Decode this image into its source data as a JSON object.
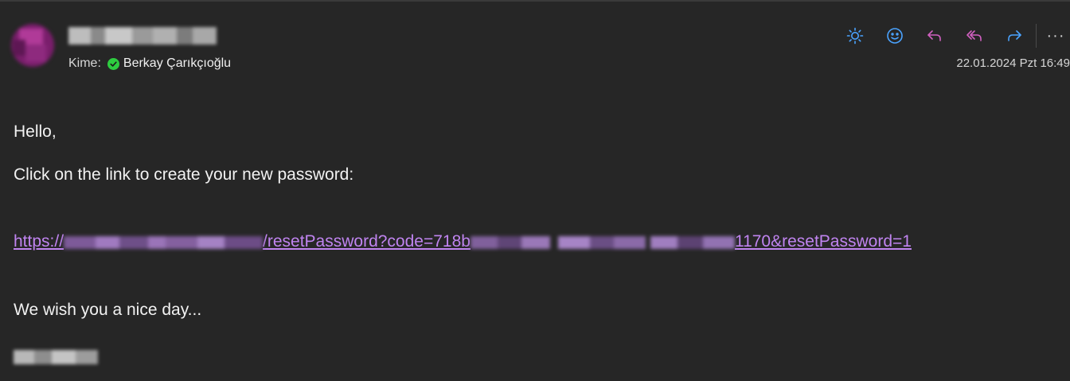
{
  "header": {
    "to_label": "Kime:",
    "recipient": "Berkay Çarıkçıoğlu",
    "date": "22.01.2024 Pzt 16:49",
    "presence_color": "#2ecc40",
    "avatar_color": "#9b2a86"
  },
  "actions": [
    {
      "name": "summarize-sun-icon",
      "color": "#4aa3ff"
    },
    {
      "name": "emoji-icon",
      "color": "#4aa3ff"
    },
    {
      "name": "reply-icon",
      "color": "#d060c0"
    },
    {
      "name": "reply-all-icon",
      "color": "#d060c0"
    },
    {
      "name": "forward-icon",
      "color": "#4aa3ff"
    }
  ],
  "more_label": "···",
  "body": {
    "greeting": "Hello,",
    "instruction": "Click on the link to create your new password:",
    "link_prefix": "https://",
    "link_middle": "/resetPassword?code=718b",
    "link_suffix": "1170&resetPassword=1",
    "closing": "We wish you a nice day..."
  },
  "link_color": "#c084f0"
}
